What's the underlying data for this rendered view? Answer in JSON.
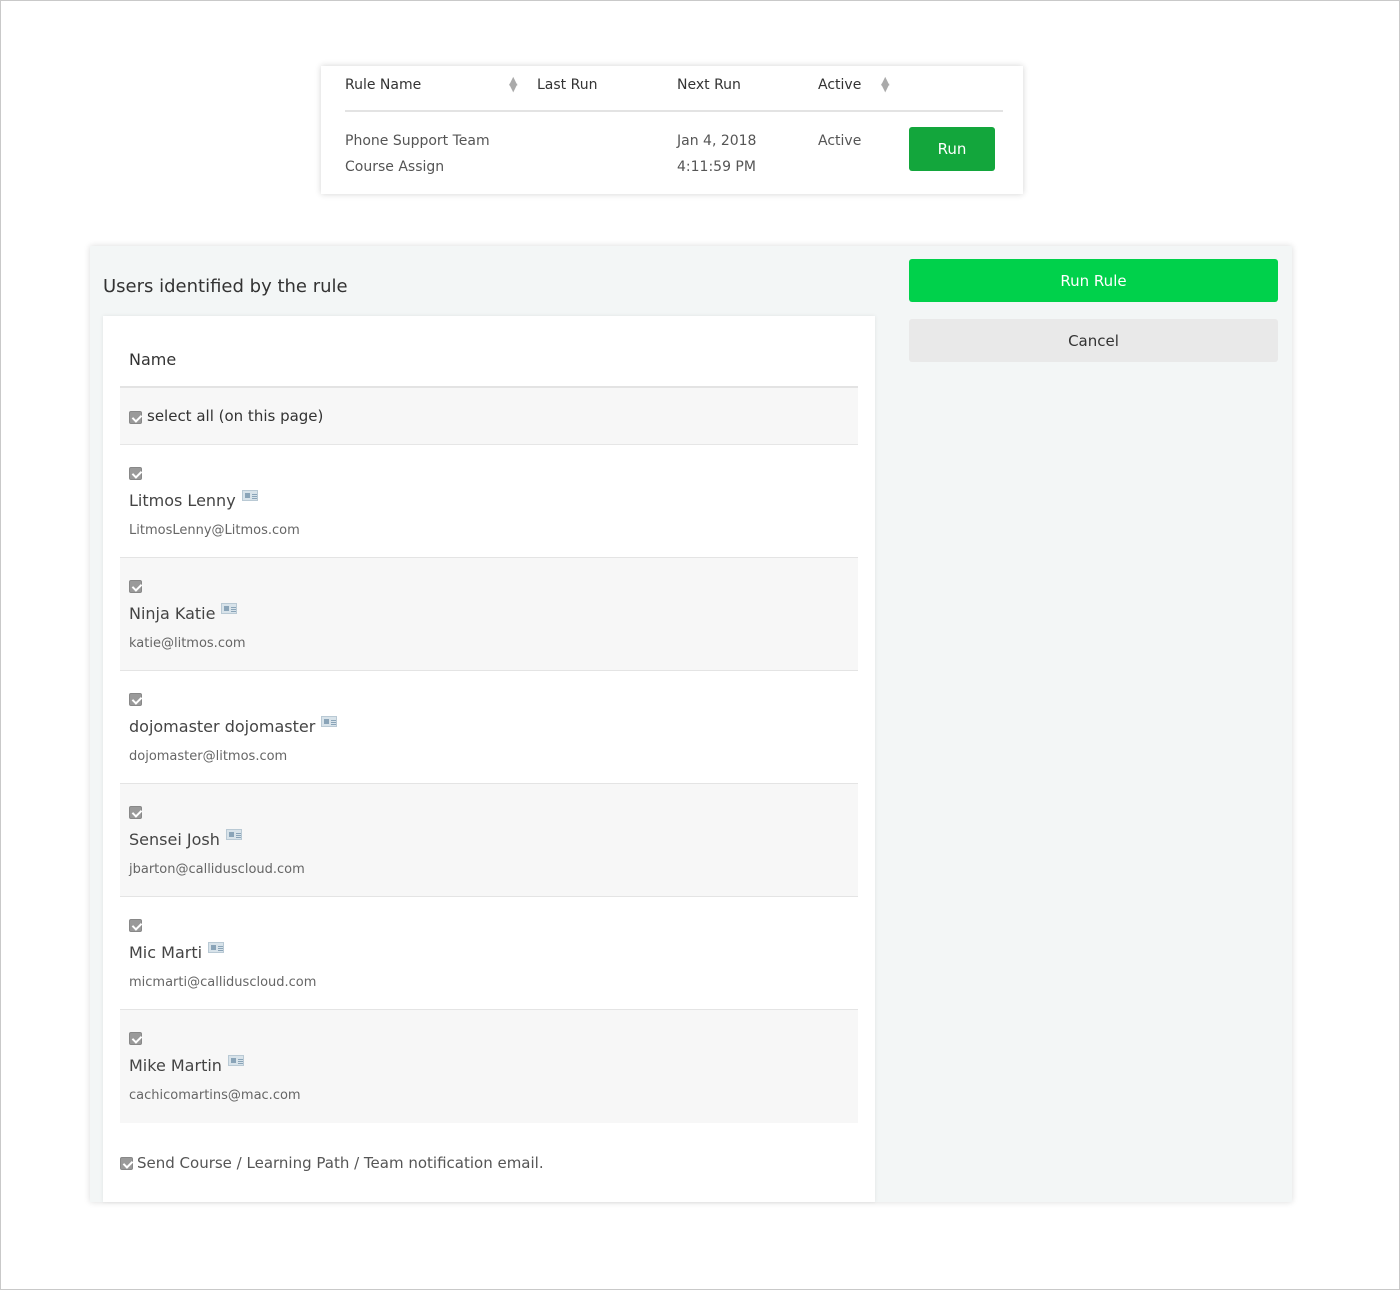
{
  "rule_table": {
    "headers": {
      "rule_name": "Rule Name",
      "last_run": "Last Run",
      "next_run": "Next Run",
      "active": "Active"
    },
    "row": {
      "rule_name_line1": "Phone Support Team",
      "rule_name_line2": "Course Assign",
      "last_run": "",
      "next_run_date": "Jan 4, 2018",
      "next_run_time": "4:11:59 PM",
      "active": "Active",
      "run_label": "Run"
    }
  },
  "panel": {
    "title": "Users identified by the rule",
    "name_header": "Name",
    "select_all_label": "select all (on this page)",
    "users": [
      {
        "name": "Litmos Lenny",
        "email": "LitmosLenny@Litmos.com"
      },
      {
        "name": "Ninja Katie",
        "email": "katie@litmos.com"
      },
      {
        "name": "dojomaster dojomaster",
        "email": "dojomaster@litmos.com"
      },
      {
        "name": "Sensei Josh",
        "email": "jbarton@calliduscloud.com"
      },
      {
        "name": "Mic Marti",
        "email": "micmarti@calliduscloud.com"
      },
      {
        "name": "Mike Martin",
        "email": "cachicomartins@mac.com"
      }
    ],
    "notification_label": "Send Course / Learning Path / Team notification email.",
    "run_rule_label": "Run Rule",
    "cancel_label": "Cancel"
  },
  "colors": {
    "run_button": "#13a63c",
    "run_rule_button": "#00d14b",
    "cancel_button": "#e9e9e9"
  }
}
